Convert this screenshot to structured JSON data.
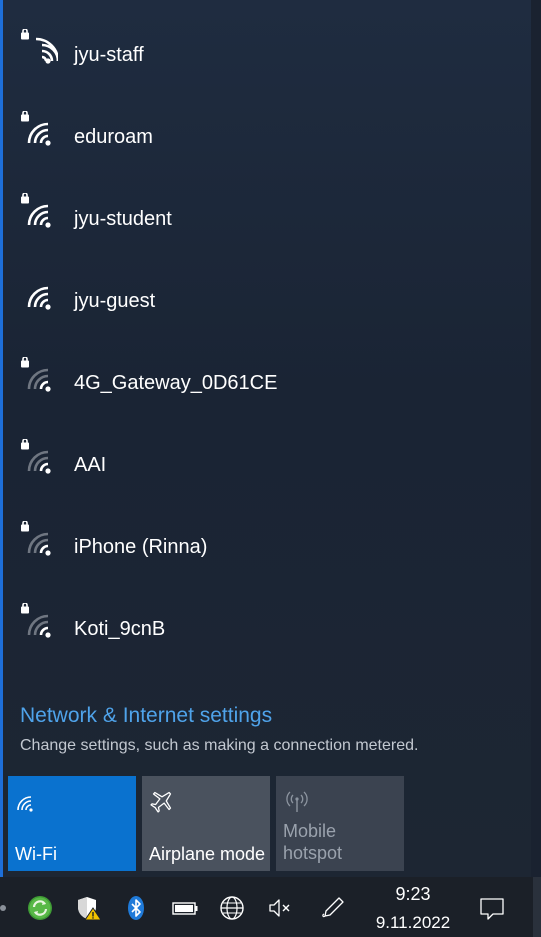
{
  "networks": [
    {
      "name": "jyu-staff",
      "secured": true,
      "signal": "full"
    },
    {
      "name": "eduroam",
      "secured": true,
      "signal": "full"
    },
    {
      "name": "jyu-student",
      "secured": true,
      "signal": "full"
    },
    {
      "name": "jyu-guest",
      "secured": false,
      "signal": "full"
    },
    {
      "name": "4G_Gateway_0D61CE",
      "secured": true,
      "signal": "weak"
    },
    {
      "name": "AAI",
      "secured": true,
      "signal": "weak"
    },
    {
      "name": "iPhone (Rinna)",
      "secured": true,
      "signal": "weak"
    },
    {
      "name": "Koti_9cnB",
      "secured": true,
      "signal": "weak"
    }
  ],
  "settings": {
    "link": "Network & Internet settings",
    "description": "Change settings, such as making a connection metered."
  },
  "tiles": {
    "wifi": {
      "label": "Wi-Fi",
      "state": "on",
      "icon": "wifi-icon"
    },
    "airplane": {
      "label": "Airplane mode",
      "state": "off",
      "icon": "airplane-icon"
    },
    "hotspot": {
      "line1": "Mobile",
      "line2": "hotspot",
      "state": "disabled",
      "icon": "hotspot-icon"
    }
  },
  "taskbar": {
    "time": "9:23",
    "date": "9.11.2022",
    "icons": [
      "sync-icon",
      "shield-warning-icon",
      "bluetooth-icon",
      "battery-icon",
      "globe-network-icon",
      "volume-muted-icon",
      "pen-icon",
      "notification-icon"
    ]
  },
  "colors": {
    "accent": "#0a72cf",
    "link": "#4fa3ea"
  }
}
